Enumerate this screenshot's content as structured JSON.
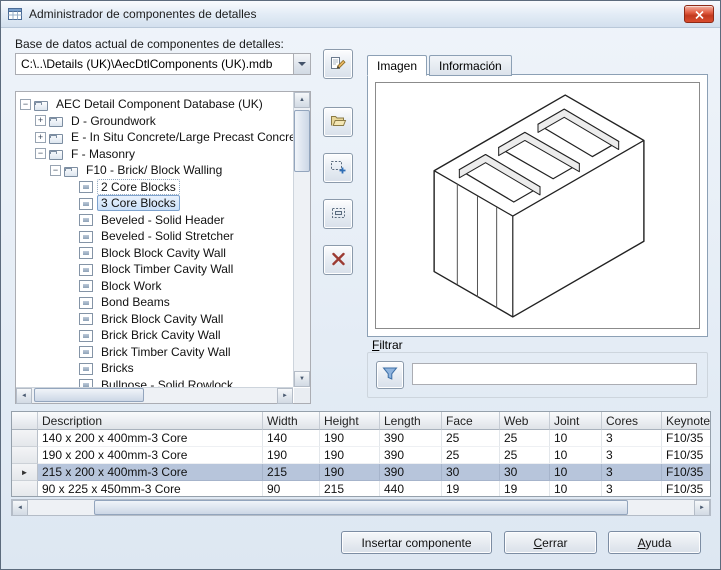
{
  "window": {
    "title": "Administrador de componentes de detalles"
  },
  "database": {
    "label": "Base de datos actual de componentes de detalles:",
    "path": "C:\\..\\Details (UK)\\AecDtlComponents (UK).mdb"
  },
  "tabs": {
    "image": "Imagen",
    "info": "Información"
  },
  "filter": {
    "label": "Filtrar",
    "value": ""
  },
  "tree": {
    "items": [
      {
        "label": "AEC Detail Component Database (UK)",
        "level": 0,
        "type": "folder",
        "state": "expanded"
      },
      {
        "label": "D - Groundwork",
        "level": 1,
        "type": "folder",
        "state": "collapsed"
      },
      {
        "label": "E - In Situ Concrete/Large Precast Concrete",
        "level": 1,
        "type": "folder",
        "state": "collapsed"
      },
      {
        "label": "F - Masonry",
        "level": 1,
        "type": "folder",
        "state": "expanded"
      },
      {
        "label": "F10 - Brick/ Block Walling",
        "level": 2,
        "type": "folder",
        "state": "expanded"
      },
      {
        "label": "2 Core Blocks",
        "level": 3,
        "type": "component",
        "focused": true
      },
      {
        "label": "3 Core Blocks",
        "level": 3,
        "type": "component",
        "selected": true
      },
      {
        "label": "Beveled - Solid Header",
        "level": 3,
        "type": "component"
      },
      {
        "label": "Beveled - Solid Stretcher",
        "level": 3,
        "type": "component"
      },
      {
        "label": "Block Block Cavity Wall",
        "level": 3,
        "type": "component"
      },
      {
        "label": "Block Timber Cavity Wall",
        "level": 3,
        "type": "component"
      },
      {
        "label": "Block Work",
        "level": 3,
        "type": "component"
      },
      {
        "label": "Bond Beams",
        "level": 3,
        "type": "component"
      },
      {
        "label": "Brick Block Cavity Wall",
        "level": 3,
        "type": "component"
      },
      {
        "label": "Brick Brick Cavity Wall",
        "level": 3,
        "type": "component"
      },
      {
        "label": "Brick Timber Cavity Wall",
        "level": 3,
        "type": "component"
      },
      {
        "label": "Bricks",
        "level": 3,
        "type": "component"
      },
      {
        "label": "Bullnose - Solid Rowlock",
        "level": 3,
        "type": "component"
      }
    ]
  },
  "table": {
    "columns": [
      "Description",
      "Width",
      "Height",
      "Length",
      "Face",
      "Web",
      "Joint",
      "Cores",
      "Keynote"
    ],
    "rows": [
      [
        "140 x 200 x 400mm-3 Core",
        "140",
        "190",
        "390",
        "25",
        "25",
        "10",
        "3",
        "F10/35"
      ],
      [
        "190 x 200 x 400mm-3 Core",
        "190",
        "190",
        "390",
        "25",
        "25",
        "10",
        "3",
        "F10/35"
      ],
      [
        "215 x 200 x 400mm-3 Core",
        "215",
        "190",
        "390",
        "30",
        "30",
        "10",
        "3",
        "F10/35"
      ],
      [
        "90 x 225 x 450mm-3 Core",
        "90",
        "215",
        "440",
        "19",
        "19",
        "10",
        "3",
        "F10/35"
      ]
    ],
    "selected_row": 2
  },
  "buttons": {
    "insert": "Insertar componente",
    "close": "Cerrar",
    "help": "Ayuda"
  },
  "colors": {
    "selection": "#b7c5db",
    "tree_selection_border": "#7da2ce",
    "close_red": "#c23a1f"
  },
  "icons": {
    "expanded": "−",
    "collapsed": "+",
    "row_pointer": "►",
    "scroll_up": "▲",
    "scroll_down": "▼",
    "scroll_left": "◄",
    "scroll_right": "►"
  }
}
